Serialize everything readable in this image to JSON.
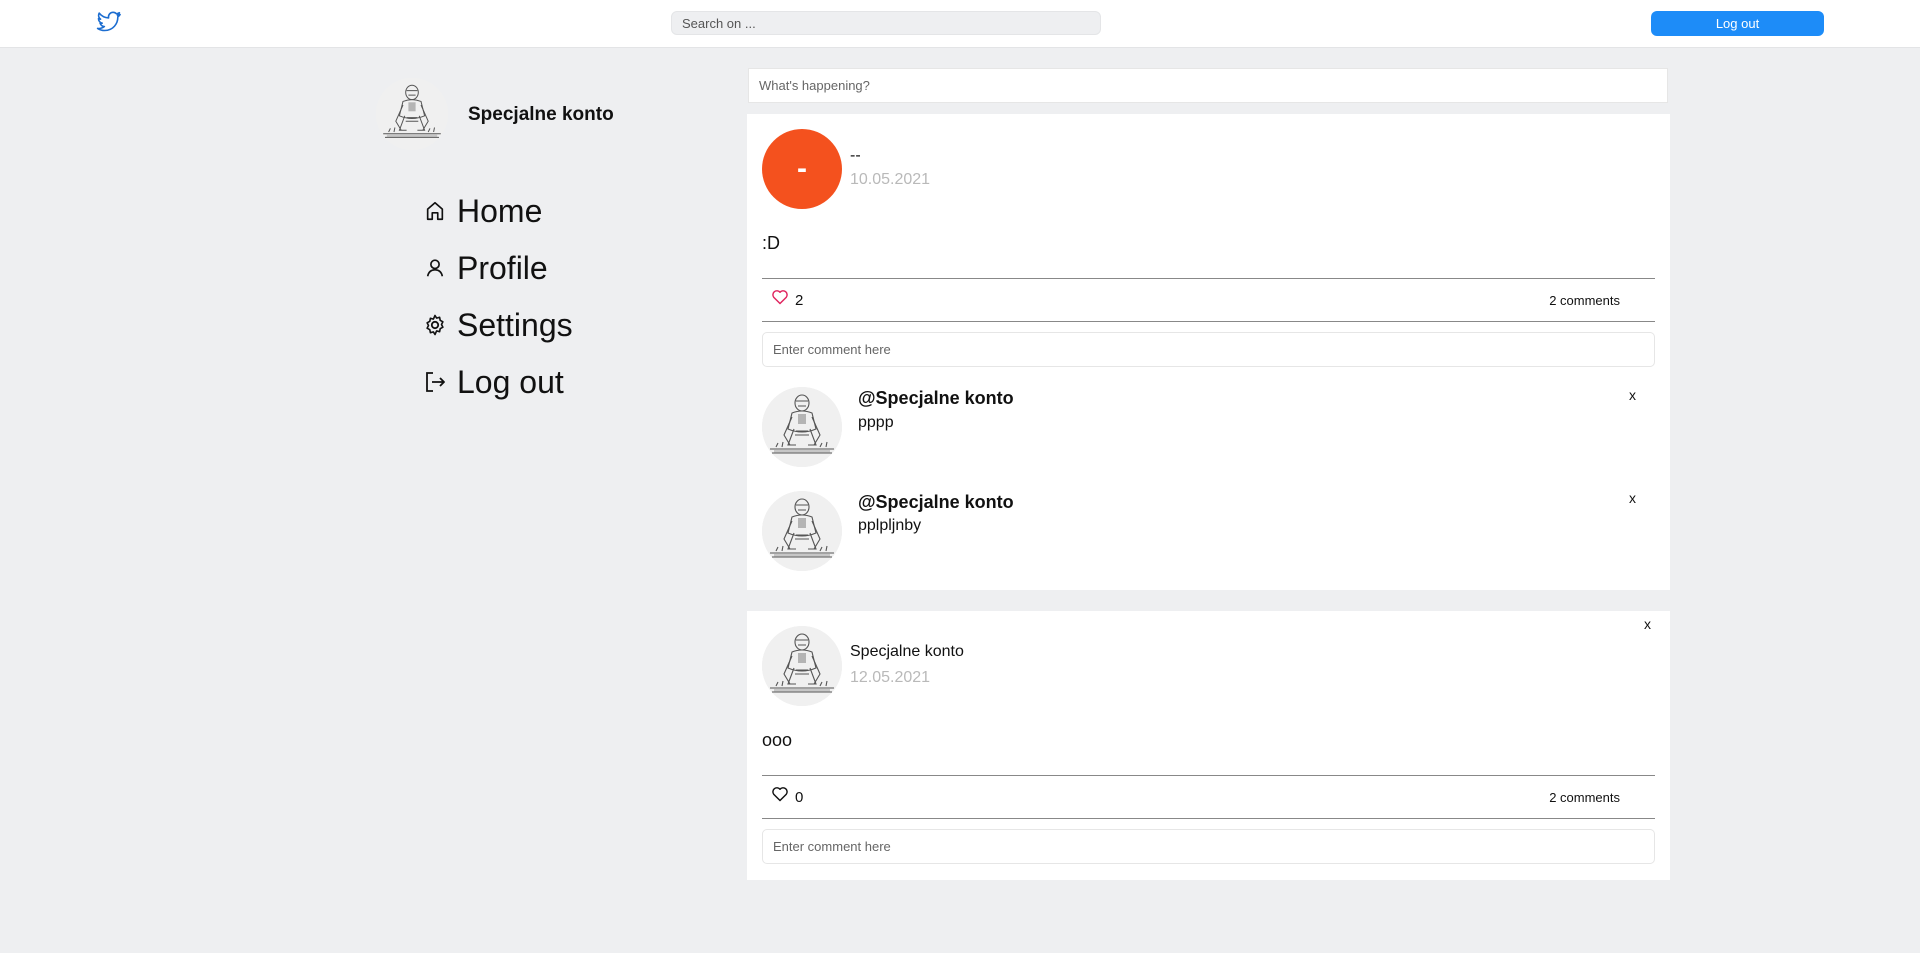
{
  "header": {
    "logo_icon": "twitter-bird-icon",
    "search_placeholder": "Search on ...",
    "logout_label": "Log out",
    "accent": "#1d8cf8"
  },
  "sidebar": {
    "user_name": "Specjalne konto",
    "items": [
      {
        "label": "Home",
        "icon": "home-icon"
      },
      {
        "label": "Profile",
        "icon": "user-icon"
      },
      {
        "label": "Settings",
        "icon": "gear-icon"
      },
      {
        "label": "Log out",
        "icon": "logout-icon"
      }
    ]
  },
  "compose": {
    "placeholder": "What's happening?"
  },
  "posts": [
    {
      "avatar_initial": "-",
      "avatar_color": "#f4511e",
      "author": "--",
      "date": "10.05.2021",
      "body": ":D",
      "likes": "2",
      "liked": true,
      "comments_label": "2 comments",
      "comment_placeholder": "Enter comment here",
      "comments": [
        {
          "author": "@Specjalne konto",
          "text": "pppp",
          "delete_label": "x"
        },
        {
          "author": "@Specjalne konto",
          "text": "pplpljnby",
          "delete_label": "x"
        }
      ]
    },
    {
      "author": "Specjalne konto",
      "date": "12.05.2021",
      "body": "ooo",
      "likes": "0",
      "liked": false,
      "comments_label": "2 comments",
      "comment_placeholder": "Enter comment here",
      "delete_label": "x"
    }
  ]
}
